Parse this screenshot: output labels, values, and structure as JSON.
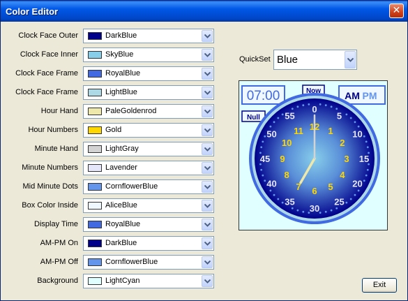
{
  "window": {
    "title": "Color Editor",
    "close_label": "✕"
  },
  "rows": [
    {
      "label": "Clock Face Outer",
      "value": "DarkBlue",
      "color": "#00008b"
    },
    {
      "label": "Clock Face Inner",
      "value": "SkyBlue",
      "color": "#87ceeb"
    },
    {
      "label": "Clock Face Frame",
      "value": "RoyalBlue",
      "color": "#4169e1"
    },
    {
      "label": "Clock Face Frame",
      "value": "LightBlue",
      "color": "#add8e6"
    },
    {
      "label": "Hour Hand",
      "value": "PaleGoldenrod",
      "color": "#eee8aa"
    },
    {
      "label": "Hour Numbers",
      "value": "Gold",
      "color": "#ffd700"
    },
    {
      "label": "Minute Hand",
      "value": "LightGray",
      "color": "#d3d3d3"
    },
    {
      "label": "Minute Numbers",
      "value": "Lavender",
      "color": "#e6e6fa"
    },
    {
      "label": "Mid Minute Dots",
      "value": "CornflowerBlue",
      "color": "#6495ed"
    },
    {
      "label": "Box Color Inside",
      "value": "AliceBlue",
      "color": "#f0f8ff"
    },
    {
      "label": "Display Time",
      "value": "RoyalBlue",
      "color": "#4169e1"
    },
    {
      "label": "AM-PM On",
      "value": "DarkBlue",
      "color": "#00008b"
    },
    {
      "label": "AM-PM Off",
      "value": "CornflowerBlue",
      "color": "#6495ed"
    },
    {
      "label": "Background",
      "value": "LightCyan",
      "color": "#e0ffff"
    }
  ],
  "quickset": {
    "label": "QuickSet",
    "value": "Blue"
  },
  "clock": {
    "time_display": "07:00",
    "now_label": "Now",
    "null_label": "Null",
    "am_label": "AM",
    "pm_label": "PM",
    "hour_numbers": [
      "12",
      "1",
      "2",
      "3",
      "4",
      "5",
      "6",
      "7",
      "8",
      "9",
      "10",
      "11"
    ],
    "minute_numbers": [
      "0",
      "5",
      "10",
      "15",
      "20",
      "25",
      "30",
      "35",
      "40",
      "45",
      "50",
      "55"
    ],
    "hour": 7,
    "minute": 0
  },
  "exit_label": "Exit"
}
